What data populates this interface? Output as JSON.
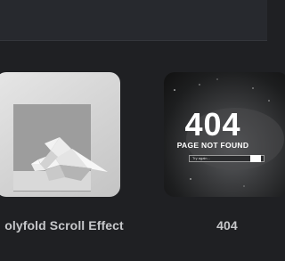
{
  "cards": [
    {
      "caption": "olyfold Scroll Effect",
      "thumbnail": {
        "subject": "origami-bird-on-paper"
      }
    },
    {
      "caption": "404",
      "thumbnail": {
        "title": "404",
        "subtitle": "PAGE NOT FOUND",
        "search_placeholder": "Try again..."
      }
    }
  ]
}
